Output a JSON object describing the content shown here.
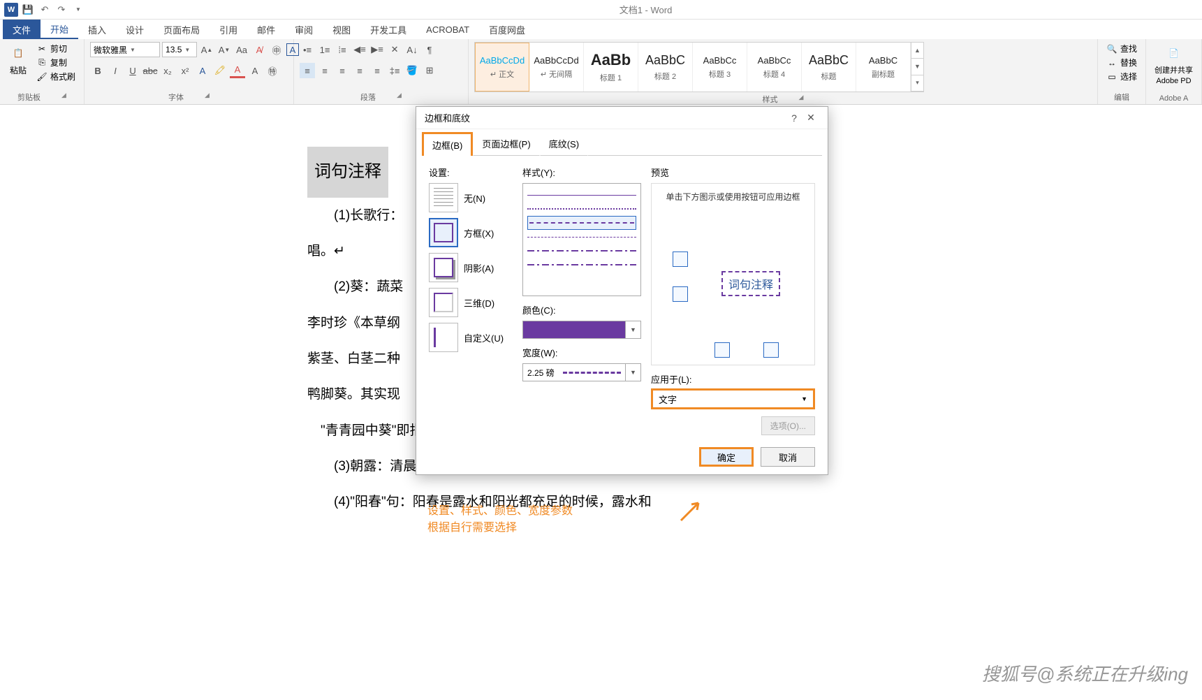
{
  "window_title": "文档1 - Word",
  "tabs": {
    "file": "文件",
    "home": "开始",
    "insert": "插入",
    "design": "设计",
    "layout": "页面布局",
    "references": "引用",
    "mailings": "邮件",
    "review": "审阅",
    "view": "视图",
    "developer": "开发工具",
    "acrobat": "ACROBAT",
    "baidu": "百度网盘"
  },
  "clipboard": {
    "paste": "粘贴",
    "cut": "剪切",
    "copy": "复制",
    "format_painter": "格式刷",
    "group": "剪贴板"
  },
  "font": {
    "name": "微软雅黑",
    "size": "13.5",
    "group": "字体"
  },
  "paragraph": {
    "group": "段落"
  },
  "styles": {
    "group": "样式",
    "items": [
      {
        "prev": "AaBbCcDd",
        "name": "↵ 正文"
      },
      {
        "prev": "AaBbCcDd",
        "name": "↵ 无间隔"
      },
      {
        "prev": "AaBb",
        "name": "标题 1"
      },
      {
        "prev": "AaBbC",
        "name": "标题 2"
      },
      {
        "prev": "AaBbCc",
        "name": "标题 3"
      },
      {
        "prev": "AaBbCc",
        "name": "标题 4"
      },
      {
        "prev": "AaBbC",
        "name": "标题"
      },
      {
        "prev": "AaBbC",
        "name": "副标题"
      }
    ]
  },
  "editing": {
    "find": "查找",
    "replace": "替换",
    "select": "选择",
    "group": "编辑"
  },
  "adobe": {
    "create": "创建并共享",
    "pdf": "Adobe PD",
    "group": "Adobe A"
  },
  "document": {
    "heading": "词句注释",
    "p1": "(1)长歌行：",
    "p2": "唱。↵",
    "p3": "(2)葵：蔬菜",
    "p4": "李时珍《本草纲",
    "p5": "紫茎、白茎二种",
    "p6": "鸭脚葵。其实现",
    "p7": "\"青青园中葵\"即指此。↵",
    "p8": "(3)朝露：清晨的露水。晞（xī）：干燥，晒干。↵",
    "p9": "(4)\"阳春\"句：阳春是露水和阳光都充足的时候，露水和"
  },
  "dialog": {
    "title": "边框和底纹",
    "tabs": {
      "border": "边框(B)",
      "page_border": "页面边框(P)",
      "shading": "底纹(S)"
    },
    "setting_label": "设置:",
    "settings": {
      "none": "无(N)",
      "box": "方框(X)",
      "shadow": "阴影(A)",
      "threed": "三维(D)",
      "custom": "自定义(U)"
    },
    "style_label": "样式(Y):",
    "color_label": "颜色(C):",
    "width_label": "宽度(W):",
    "width_value": "2.25 磅",
    "preview_label": "预览",
    "preview_hint": "单击下方图示或使用按钮可应用边框",
    "preview_text": "词句注释",
    "apply_label": "应用于(L):",
    "apply_value": "文字",
    "options": "选项(O)...",
    "ok": "确定",
    "cancel": "取消"
  },
  "annotation": {
    "l1": "设置、样式、颜色、宽度参数",
    "l2": "根据自行需要选择"
  },
  "watermark": "搜狐号@系统正在升级ing"
}
